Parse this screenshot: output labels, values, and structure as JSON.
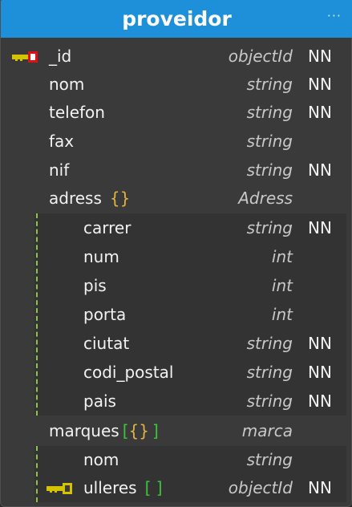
{
  "entity": {
    "title": "proveidor",
    "menu_glyph": "···",
    "fields": [
      {
        "name": "_id",
        "type": "objectId",
        "nn": "NN",
        "key": "pk-key-icon"
      },
      {
        "name": "nom",
        "type": "string",
        "nn": "NN"
      },
      {
        "name": "telefon",
        "type": "string",
        "nn": "NN"
      },
      {
        "name": "fax",
        "type": "string",
        "nn": ""
      },
      {
        "name": "nif",
        "type": "string",
        "nn": "NN"
      },
      {
        "name": "adress",
        "brace": "{}",
        "type": "Adress",
        "nn": ""
      }
    ],
    "adress_fields": [
      {
        "name": "carrer",
        "type": "string",
        "nn": "NN"
      },
      {
        "name": "num",
        "type": "int",
        "nn": ""
      },
      {
        "name": "pis",
        "type": "int",
        "nn": ""
      },
      {
        "name": "porta",
        "type": "int",
        "nn": ""
      },
      {
        "name": "ciutat",
        "type": "string",
        "nn": "NN"
      },
      {
        "name": "codi_postal",
        "type": "string",
        "nn": "NN"
      },
      {
        "name": "pais",
        "type": "string",
        "nn": "NN"
      }
    ],
    "marques": {
      "name": "marques",
      "open": "[",
      "brace": "{}",
      "close": "]",
      "type": "marca",
      "nn": ""
    },
    "marques_fields": [
      {
        "name": "nom",
        "type": "string",
        "nn": ""
      },
      {
        "name": "ulleres",
        "array": "[ ]",
        "type": "objectId",
        "nn": "NN",
        "key": "fk-key-icon"
      }
    ]
  },
  "colors": {
    "header": "#1e8fd9",
    "body": "#3a3a3a",
    "brace": "#e3b341",
    "array": "#3bc43b",
    "pk_key": "#d6c300",
    "pk_lock": "#e01010",
    "fk_key": "#d6c300"
  }
}
